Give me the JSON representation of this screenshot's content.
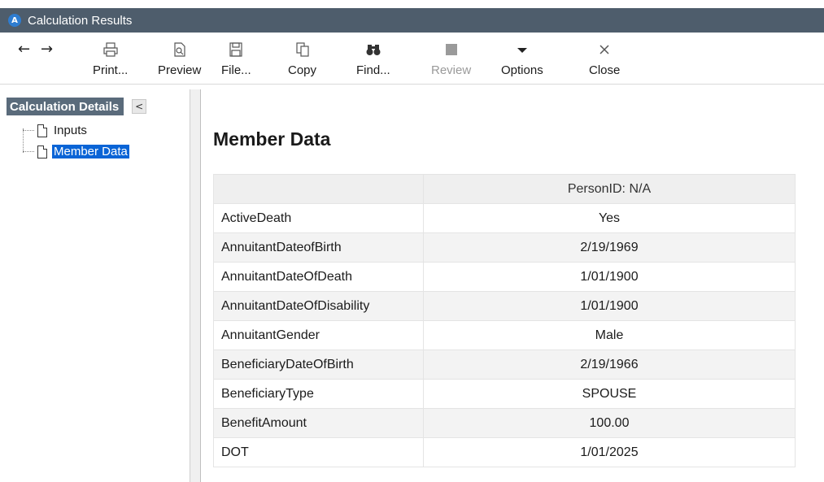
{
  "window": {
    "title": "Calculation Results",
    "app_icon_letter": "A"
  },
  "toolbar": {
    "back_glyph": "←",
    "forward_glyph": "→",
    "print_label": "Print...",
    "preview_label": "Preview",
    "file_label": "File...",
    "copy_label": "Copy",
    "find_label": "Find...",
    "review_label": "Review",
    "options_label": "Options",
    "close_label": "Close"
  },
  "sidebar": {
    "title": "Calculation Details",
    "collapse_glyph": "<",
    "items": [
      {
        "label": "Inputs",
        "selected": false
      },
      {
        "label": "Member Data",
        "selected": true
      }
    ]
  },
  "main": {
    "heading": "Member Data",
    "table": {
      "columns": [
        "",
        "PersonID: N/A"
      ],
      "rows": [
        {
          "field": "ActiveDeath",
          "value": "Yes"
        },
        {
          "field": "AnnuitantDateofBirth",
          "value": "2/19/1969"
        },
        {
          "field": "AnnuitantDateOfDeath",
          "value": "1/01/1900"
        },
        {
          "field": "AnnuitantDateOfDisability",
          "value": "1/01/1900"
        },
        {
          "field": "AnnuitantGender",
          "value": "Male"
        },
        {
          "field": "BeneficiaryDateOfBirth",
          "value": "2/19/1966"
        },
        {
          "field": "BeneficiaryType",
          "value": "SPOUSE"
        },
        {
          "field": "BenefitAmount",
          "value": "100.00"
        },
        {
          "field": "DOT",
          "value": "1/01/2025"
        }
      ]
    }
  },
  "colors": {
    "titlebar": "#4e5d6c",
    "pane_header": "#5a6b7b",
    "selection": "#0a64d6"
  }
}
